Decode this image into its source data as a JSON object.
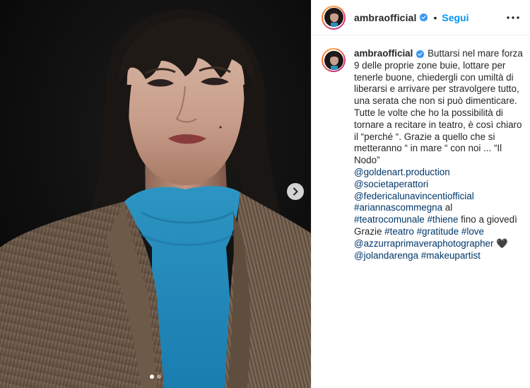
{
  "post": {
    "username": "ambraofficial",
    "follow_label": "Segui",
    "separator": "•",
    "more_icon": "more-horizontal-icon",
    "verified_icon": "verified-badge-icon"
  },
  "caption": {
    "username": "ambraofficial",
    "intro": "Buttarsi nel mare forza 9 delle proprie zone buie, lottare per tenerle buone, chiedergli con umiltà di liberarsi e arrivare per stravolgere tutto, una serata che non si può dimenticare. Tutte le volte che ho la possibilità di tornare a recitare in teatro, è così chiaro il “perché “. Grazie a quello che si metteranno “ in mare “ con noi ... “Il Nodo”",
    "mention1": "@goldenart.production",
    "mention2": "@societaperattori",
    "mention3": "@federicalunavincentiofficial",
    "mention4": "#ariannascommegna",
    "text_al": " al",
    "tag_teatrocomunale": "#teatrocomunale",
    "tag_thiene": "#thiene",
    "text_fino": " fino a giovedì",
    "text_grazie": "Grazie ",
    "tag_teatro": "#teatro",
    "tag_gratitude": "#gratitude",
    "tag_love": "#love",
    "mention_azzurra": "@azzurraprimaveraphotographer",
    "heart": " 🖤",
    "mention_jolanda": "@jolandarenga",
    "tag_makeup": "#makeupartist"
  },
  "carousel": {
    "total_slides": 2,
    "active_slide": 1,
    "next_icon": "chevron-right-icon"
  },
  "colors": {
    "link": "#00376b",
    "follow": "#0095f6",
    "verified": "#3897f0",
    "text": "#262626"
  }
}
